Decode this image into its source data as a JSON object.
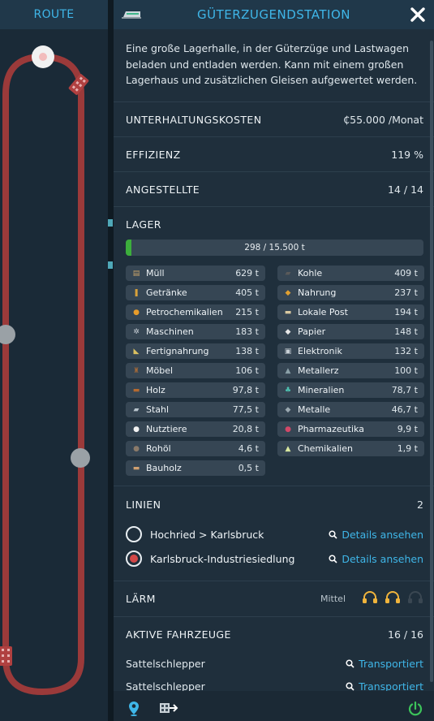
{
  "route": {
    "title": "ROUTE"
  },
  "header": {
    "title": "GÜTERZUGENDSTATION",
    "close_icon": "close-icon"
  },
  "description": "Eine große Lagerhalle, in der Güterzüge und Lastwagen beladen und entladen werden. Kann mit einem großen Lagerhaus und zusätzlichen Gleisen aufgewertet werden.",
  "stats": [
    {
      "label": "UNTERHALTUNGSKOSTEN",
      "value": "₵55.000 /Monat"
    },
    {
      "label": "EFFIZIENZ",
      "value": "119 %"
    },
    {
      "label": "ANGESTELLTE",
      "value": "14 / 14"
    }
  ],
  "lager": {
    "label": "LAGER",
    "capacity_text": "298 / 15.500 t",
    "fill_fraction": 0.0192,
    "fill_color": "#3cae3c",
    "goods": [
      {
        "name": "Müll",
        "amount": "629 t",
        "icon": "trash-icon"
      },
      {
        "name": "Kohle",
        "amount": "409 t",
        "icon": "coal-icon"
      },
      {
        "name": "Getränke",
        "amount": "405 t",
        "icon": "bottle-icon"
      },
      {
        "name": "Nahrung",
        "amount": "237 t",
        "icon": "food-icon"
      },
      {
        "name": "Petrochemikalien",
        "amount": "215 t",
        "icon": "drop-icon"
      },
      {
        "name": "Lokale Post",
        "amount": "194 t",
        "icon": "mail-icon"
      },
      {
        "name": "Maschinen",
        "amount": "183 t",
        "icon": "gears-icon"
      },
      {
        "name": "Papier",
        "amount": "148 t",
        "icon": "paper-icon"
      },
      {
        "name": "Fertignahrung",
        "amount": "138 t",
        "icon": "ready-food-icon"
      },
      {
        "name": "Elektronik",
        "amount": "132 t",
        "icon": "chip-icon"
      },
      {
        "name": "Möbel",
        "amount": "106 t",
        "icon": "chair-icon"
      },
      {
        "name": "Metallerz",
        "amount": "100 t",
        "icon": "ore-icon"
      },
      {
        "name": "Holz",
        "amount": "97,8 t",
        "icon": "log-icon"
      },
      {
        "name": "Mineralien",
        "amount": "78,7 t",
        "icon": "minerals-icon"
      },
      {
        "name": "Stahl",
        "amount": "77,5 t",
        "icon": "steel-icon"
      },
      {
        "name": "Metalle",
        "amount": "46,7 t",
        "icon": "ingot-icon"
      },
      {
        "name": "Nutztiere",
        "amount": "20,8 t",
        "icon": "sheep-icon"
      },
      {
        "name": "Pharmazeutika",
        "amount": "9,9 t",
        "icon": "pill-icon"
      },
      {
        "name": "Rohöl",
        "amount": "4,6 t",
        "icon": "oil-drop-icon"
      },
      {
        "name": "Chemikalien",
        "amount": "1,9 t",
        "icon": "flask-icon"
      },
      {
        "name": "Bauholz",
        "amount": "0,5 t",
        "icon": "planks-icon"
      }
    ]
  },
  "linien": {
    "label": "LINIEN",
    "count": "2",
    "lines": [
      {
        "name": "Hochried > Karlsbruck",
        "selected": false,
        "link": "Details ansehen"
      },
      {
        "name": "Karlsbruck-Industriesiedlung",
        "selected": true,
        "link": "Details ansehen"
      }
    ]
  },
  "laerm": {
    "label": "LÄRM",
    "level": "Mittel",
    "level_of_3": 2
  },
  "fahrzeuge": {
    "label": "AKTIVE FAHRZEUGE",
    "count": "16 / 16",
    "vehicles": [
      {
        "name": "Sattelschlepper",
        "status": "Transportiert"
      },
      {
        "name": "Sattelschlepper",
        "status": "Transportiert"
      }
    ]
  },
  "colors": {
    "accent": "#3fb6e8",
    "route_line": "#9b3a3a",
    "selected_line": "#d24848",
    "power": "#3cc35a",
    "noise_on": "#f0b43c",
    "noise_off": "#3a4752"
  }
}
